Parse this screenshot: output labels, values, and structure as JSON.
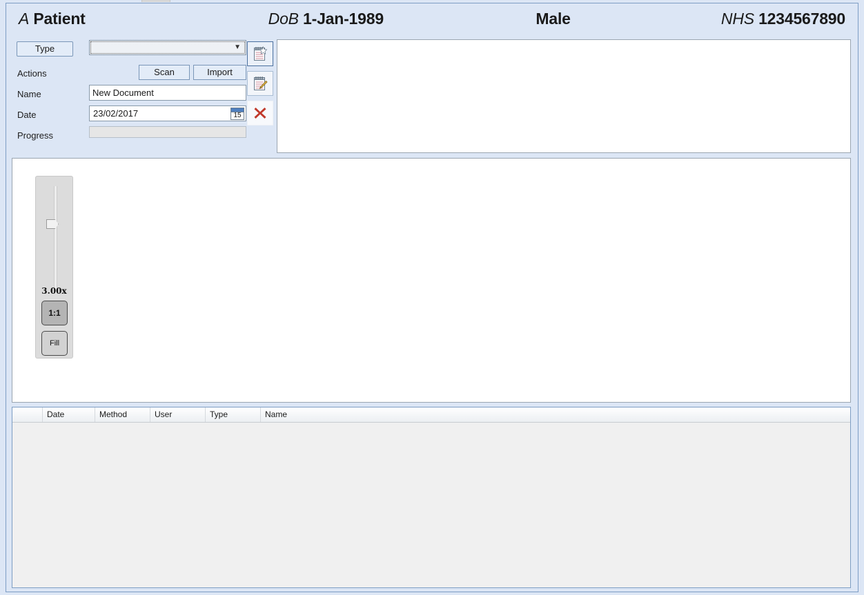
{
  "patient_header": {
    "name_label": "A",
    "name_value": "Patient",
    "dob_label": "DoB",
    "dob_value": "1-Jan-1989",
    "sex_value": "Male",
    "nhs_label": "NHS",
    "nhs_value": "1234567890"
  },
  "form": {
    "type_button": "Type",
    "type_combo_value": "",
    "actions_label": "Actions",
    "scan_button": "Scan",
    "import_button": "Import",
    "name_label": "Name",
    "name_value": "New Document",
    "name_placeholder": "",
    "date_label": "Date",
    "date_value": "23/02/2017",
    "calendar_day": "15",
    "progress_label": "Progress",
    "progress_percent": 0
  },
  "icon_buttons": [
    {
      "name": "new-note-button",
      "icon": "notepad-new-icon"
    },
    {
      "name": "edit-note-button",
      "icon": "notepad-edit-icon"
    },
    {
      "name": "delete-button",
      "icon": "red-cross-icon"
    }
  ],
  "notes_panel": {
    "content": ""
  },
  "viewer": {
    "zoom_value": "3.00x",
    "fit_one_to_one_button": "1:1",
    "fit_fill_button": "Fill",
    "image_content": ""
  },
  "history_table": {
    "columns": [
      "",
      "Date",
      "Method",
      "User",
      "Type",
      "Name"
    ],
    "rows": []
  },
  "colors": {
    "window_background": "#dce6f5",
    "panel_border": "#7d9dc4",
    "panel_white": "#ffffff",
    "table_body": "#f0f0f0",
    "delete_icon": "#c0392b",
    "calendar_header": "#4f7fbf",
    "zoom_strip": "#dcdcdc"
  }
}
